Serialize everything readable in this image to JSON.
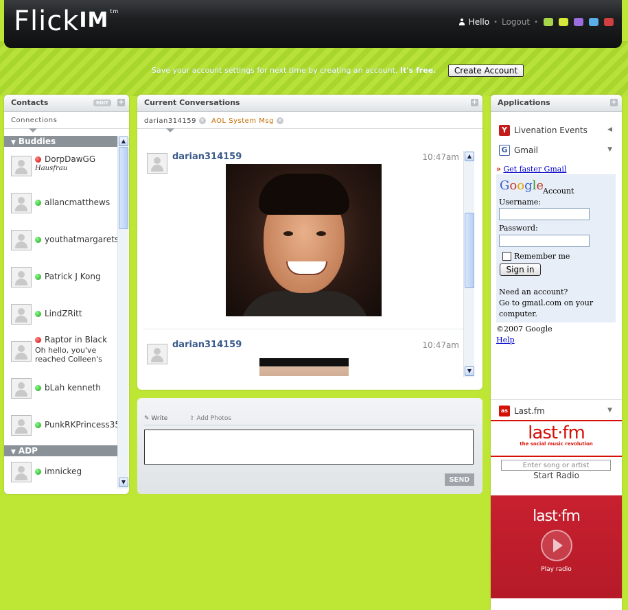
{
  "header": {
    "logo": "Flick",
    "logo_im": "IM",
    "logo_tm": "tm",
    "hello": "Hello",
    "logout": "Logout",
    "theme_colors": [
      "#a8d64a",
      "#d6e83a",
      "#9b6ee0",
      "#5aaee6",
      "#d04040"
    ]
  },
  "promo": {
    "text": "Save your account settings for next time by creating an account.",
    "bold": "It's free.",
    "button": "Create Account"
  },
  "contacts": {
    "title": "Contacts",
    "edit": "EDIT",
    "tab": "Connections",
    "groups": [
      {
        "name": "Buddies"
      },
      {
        "name": "ADP"
      }
    ],
    "buddies": [
      {
        "name": "DorpDawGG",
        "status": "away",
        "sub": "Hausfrau"
      },
      {
        "name": "allancmatthews",
        "status": "online"
      },
      {
        "name": "youthatmargarets",
        "status": "online"
      },
      {
        "name": "Patrick J Kong",
        "status": "online"
      },
      {
        "name": "LindZRitt",
        "status": "online"
      },
      {
        "name": "Raptor in Black",
        "status": "away",
        "msg": "Oh hello, you've reached Colleen's general away"
      },
      {
        "name": "bLah kenneth",
        "status": "online"
      },
      {
        "name": "PunkRKPrincess35",
        "status": "online"
      }
    ],
    "adp_buddies": [
      {
        "name": "imnickeg",
        "status": "online"
      }
    ]
  },
  "conversations": {
    "title": "Current Conversations",
    "tabs": [
      "darian314159",
      "AOL System Msg"
    ],
    "messages": [
      {
        "sender": "darian314159",
        "time": "10:47am"
      },
      {
        "sender": "darian314159",
        "time": "10:47am"
      }
    ]
  },
  "compose": {
    "write": "Write",
    "add_photos": "Add Photos",
    "send": "SEND"
  },
  "applications": {
    "title": "Applications",
    "items": [
      {
        "label": "Livenation Events",
        "icon": "livenation-icon"
      },
      {
        "label": "Gmail",
        "icon": "gmail-icon"
      },
      {
        "label": "Last.fm",
        "icon": "lastfm-icon"
      }
    ],
    "gmail": {
      "faster": "Get faster Gmail",
      "logo": "Google",
      "account": "Account",
      "username": "Username:",
      "password": "Password:",
      "remember": "Remember me",
      "signin": "Sign in",
      "need": "Need an account?",
      "goto": "Go to gmail.com on your computer.",
      "copyright": "©2007 Google",
      "help": "Help"
    },
    "lastfm": {
      "logo": "last·fm",
      "tagline": "the social music revolution",
      "input_placeholder": "Enter song or artist",
      "start": "Start Radio",
      "play": "Play radio"
    }
  }
}
